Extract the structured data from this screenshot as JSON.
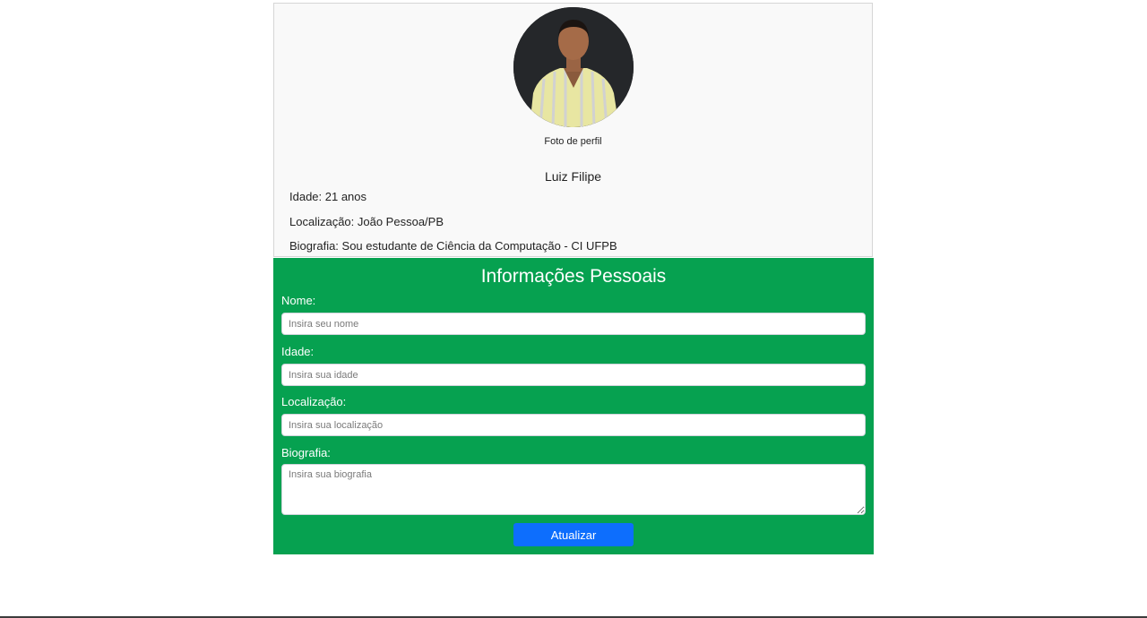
{
  "profile": {
    "photo_caption": "Foto de perfil",
    "name": "Luiz Filipe",
    "age_line": "Idade: 21 anos",
    "location_line": "Localização: João Pessoa/PB",
    "bio_line": "Biografia: Sou estudante de Ciência da Computação - CI UFPB"
  },
  "form": {
    "title": "Informações Pessoais",
    "name_label": "Nome:",
    "name_placeholder": "Insira seu nome",
    "age_label": "Idade:",
    "age_placeholder": "Insira sua idade",
    "location_label": "Localização:",
    "location_placeholder": "Insira sua localização",
    "bio_label": "Biografia:",
    "bio_placeholder": "Insira sua biografia",
    "submit_label": "Atualizar"
  },
  "colors": {
    "form_background": "#06a150",
    "button_background": "#0d6efd",
    "profile_background": "#f9f9f9"
  },
  "icons": {
    "avatar": "profile-photo"
  }
}
